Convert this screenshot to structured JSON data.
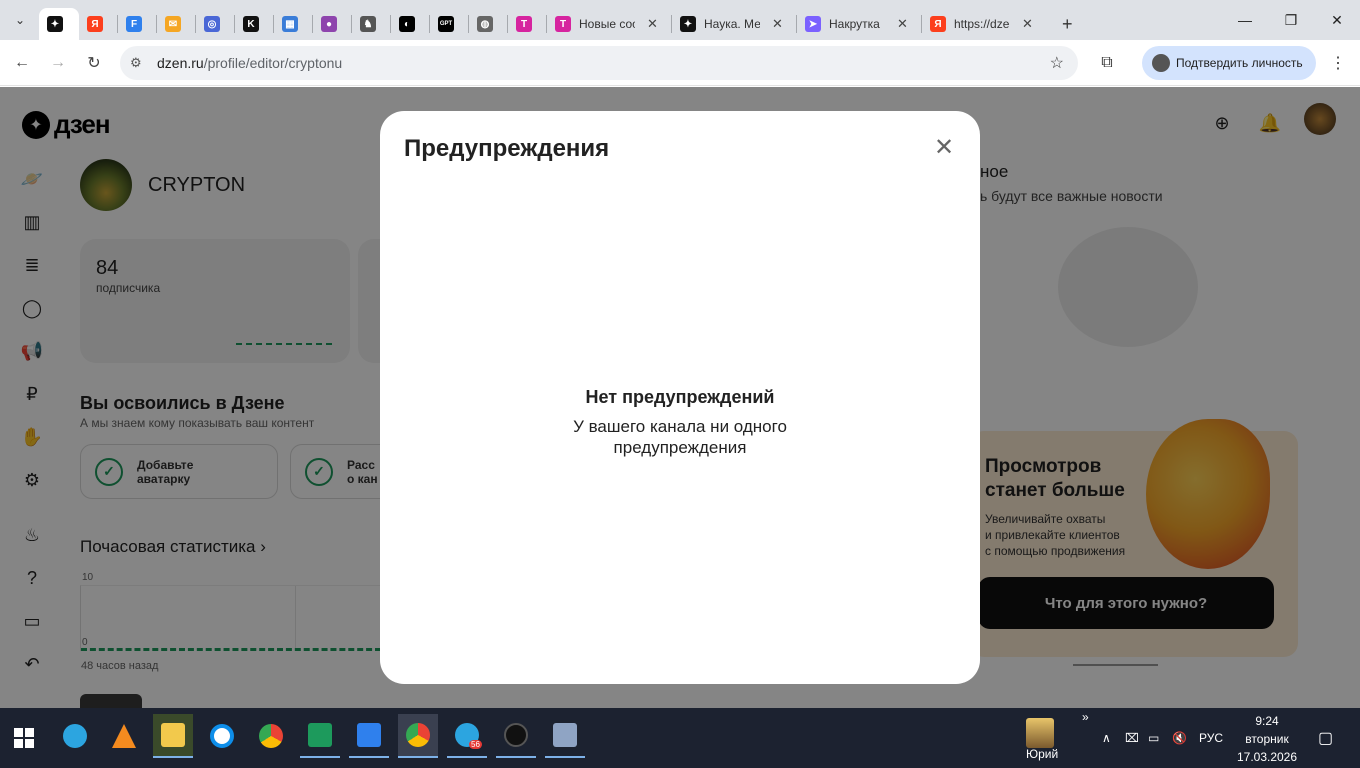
{
  "browser": {
    "tabs": [
      {
        "title": "",
        "color": "#111111",
        "glyph": "✦",
        "active": true
      },
      {
        "title": "",
        "color": "#fc3f1d",
        "glyph": "Я"
      },
      {
        "title": "",
        "color": "#2f80ed",
        "glyph": "F"
      },
      {
        "title": "",
        "color": "#f5a623",
        "glyph": "✉"
      },
      {
        "title": "",
        "color": "#4a67d6",
        "glyph": "◎"
      },
      {
        "title": "",
        "color": "#111111",
        "glyph": "K"
      },
      {
        "title": "",
        "color": "#3b7dd8",
        "glyph": "▦"
      },
      {
        "title": "",
        "color": "#8e44ad",
        "glyph": "●"
      },
      {
        "title": "",
        "color": "#555555",
        "glyph": "♞"
      },
      {
        "title": "",
        "color": "#000000",
        "glyph": "◐"
      },
      {
        "title": "",
        "color": "#000000",
        "glyph": "GPT"
      },
      {
        "title": "",
        "color": "#666666",
        "glyph": "◍"
      },
      {
        "title": "",
        "color": "#d6249f",
        "glyph": "T"
      },
      {
        "title": "Новые соо",
        "color": "#d6249f",
        "glyph": "T"
      },
      {
        "title": "Наука. Ме",
        "color": "#111111",
        "glyph": "✦"
      },
      {
        "title": "Накрутка ",
        "color": "#7b61ff",
        "glyph": "➤"
      },
      {
        "title": "https://dze",
        "color": "#fc3f1d",
        "glyph": "Я"
      }
    ],
    "new_tab": "+",
    "window_controls": {
      "minimize": "—",
      "restore": "❐",
      "close": "✕"
    },
    "url_host": "dzen.ru",
    "url_path": "/profile/editor/cryptonu",
    "verify_label": "Подтвердить личность"
  },
  "dzen": {
    "logo": "дзен",
    "channel_name": "CRYPTON",
    "subscribers_count": "84",
    "subscribers_label": "подписчика",
    "adapt_title": "Вы освоились в Дзене",
    "adapt_subtitle": "А мы знаем кому показывать ваш контент",
    "tasks": [
      {
        "line1": "Добавьте",
        "line2": "аватарку"
      },
      {
        "line1": "Расс",
        "line2": "о кан"
      }
    ],
    "hourly_title": "Почасовая статистика",
    "graph_top": "10",
    "graph_zero": "0",
    "graph_caption": "48 часов назад",
    "right_title": "ное",
    "right_subtitle": "ь будут все важные новости",
    "promo": {
      "title_line1": "Просмотров",
      "title_line2": "станет больше",
      "text_line1": "Увеличивайте охваты",
      "text_line2": "и привлекайте клиентов",
      "text_line3": "с помощью продвижения",
      "button": "Что для этого нужно?"
    }
  },
  "modal": {
    "title": "Предупреждения",
    "empty_title": "Нет предупреждений",
    "empty_text": "У вашего канала ни одного предупреждения"
  },
  "taskbar": {
    "user_label": "Юрий",
    "lang": "РУС",
    "time": "9:24",
    "weekday": "вторник",
    "date": "17.03.2026",
    "telegram_badge": "56"
  }
}
